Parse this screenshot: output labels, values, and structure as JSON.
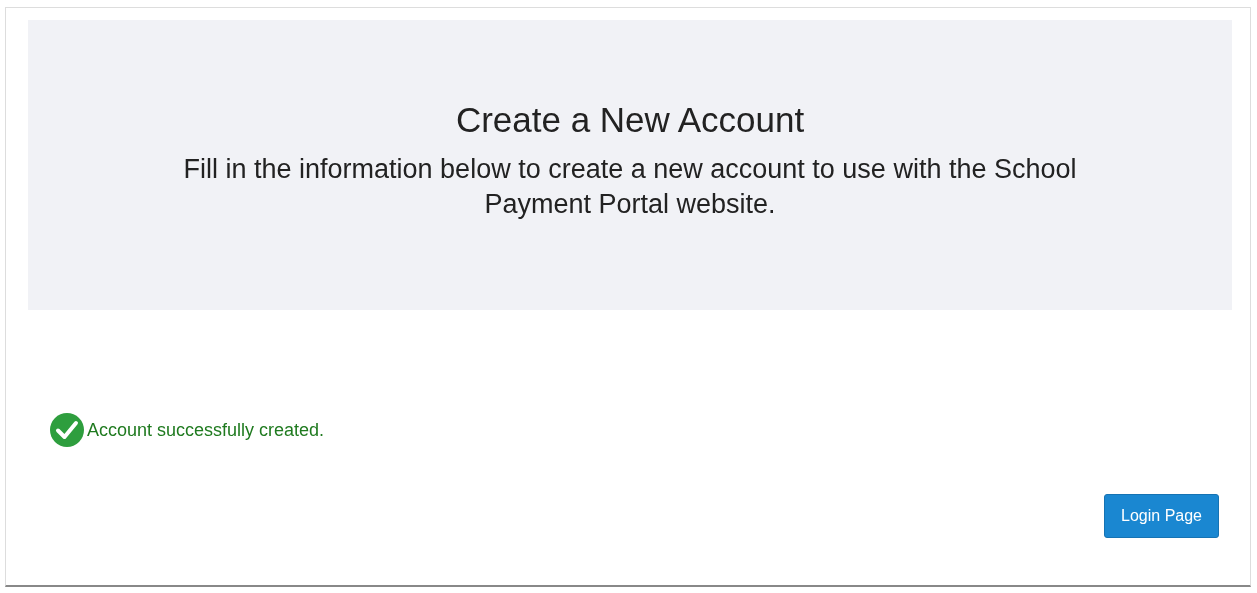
{
  "header": {
    "title": "Create a New Account",
    "subtitle": "Fill in the information below to create a new account to use with the School Payment Portal website."
  },
  "message": {
    "kind": "success",
    "text": "Account successfully created."
  },
  "buttons": [
    {
      "label": "Login Page"
    }
  ]
}
